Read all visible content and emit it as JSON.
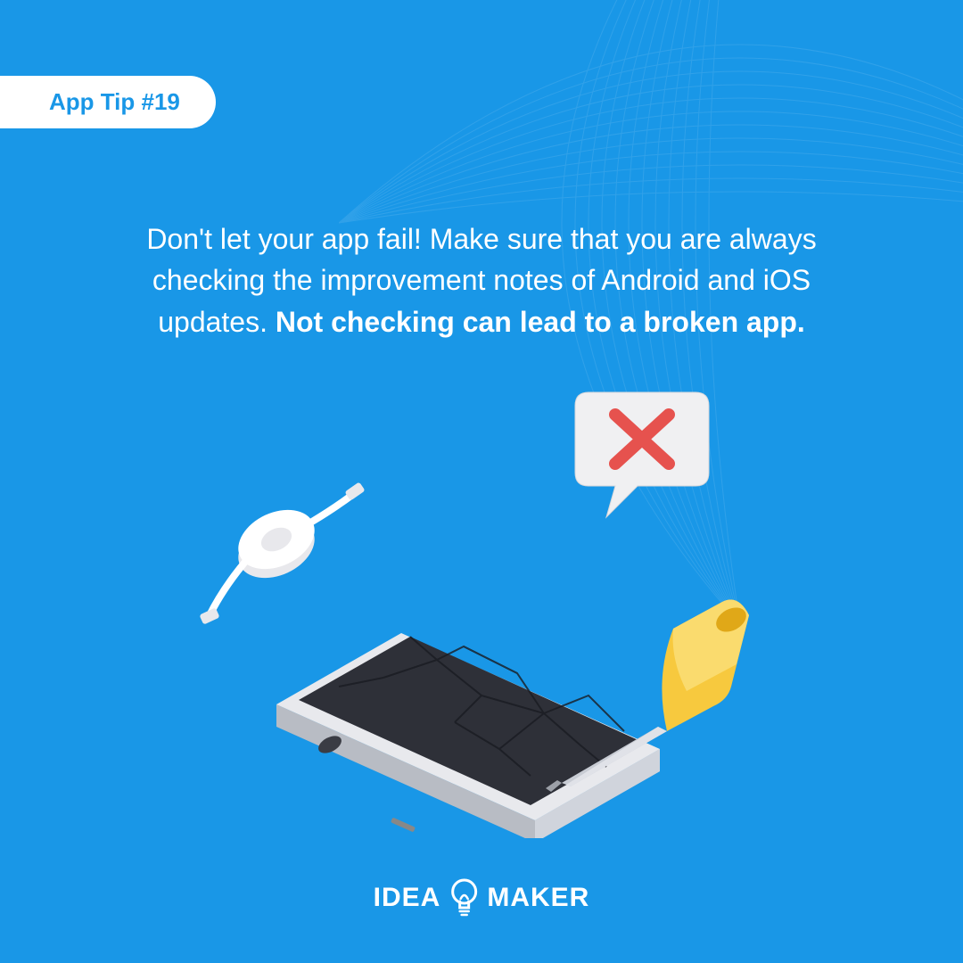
{
  "badge": {
    "label": "App Tip #19"
  },
  "tip": {
    "line1": "Don't let your app fail! Make sure that you are always",
    "line2": "checking the improvement notes of Android and iOS",
    "line3_prefix": "updates. ",
    "line3_bold": "Not checking can lead to a broken app."
  },
  "logo": {
    "left": "IDEA",
    "right": "MAKER"
  },
  "colors": {
    "background": "#1997e7",
    "accent_red": "#e6524e",
    "yellow": "#f7c93e",
    "white": "#ffffff"
  }
}
